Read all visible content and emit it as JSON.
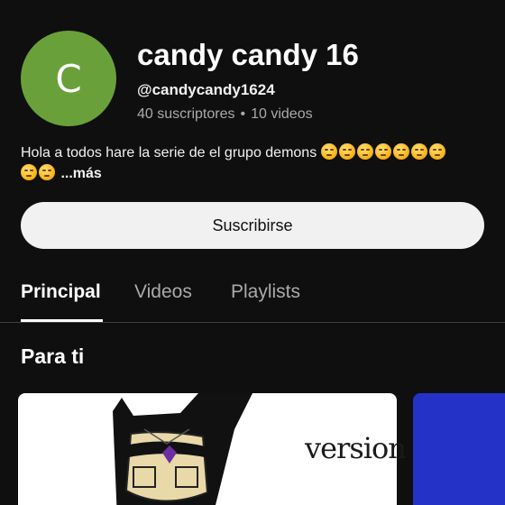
{
  "channel": {
    "avatar_letter": "C",
    "avatar_color": "#6aa039",
    "name": "candy candy 16",
    "handle": "@candycandy1624",
    "subscribers": "40 suscriptores",
    "separator": "•",
    "videos": "10 videos"
  },
  "description": {
    "text": "Hola a  todos hare la serie de el grupo demons ",
    "emoji_icon": "smirk-emoji-icon",
    "more": "...más"
  },
  "actions": {
    "subscribe_label": "Suscribirse"
  },
  "tabs": [
    {
      "label": "Principal",
      "active": true
    },
    {
      "label": "Videos",
      "active": false
    },
    {
      "label": "Playlists",
      "active": false
    }
  ],
  "section": {
    "title": "Para ti"
  },
  "videos": [
    {
      "thumbnail_text": "version",
      "background": "#ffffff"
    },
    {
      "background": "#2432c7"
    }
  ]
}
